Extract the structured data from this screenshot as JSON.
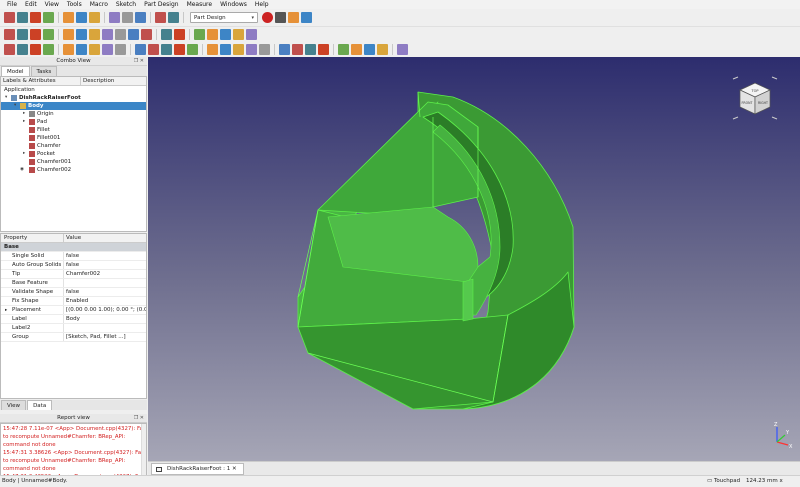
{
  "menu": [
    "File",
    "Edit",
    "View",
    "Tools",
    "Macro",
    "Sketch",
    "Part Design",
    "Measure",
    "Windows",
    "Help"
  ],
  "toolbar": {
    "workbench": "Part Design",
    "row1_icons": [
      "new-icon",
      "open-icon",
      "save-icon",
      "print-icon",
      "cut-icon",
      "copy-icon",
      "paste-icon",
      "undo-icon",
      "redo-icon",
      "refresh-icon",
      "whats-this-icon",
      "workbench-icon",
      "macro-record-icon",
      "macro-stop-icon",
      "macro-edit-icon",
      "macro-run-icon"
    ],
    "row2_icons": [
      "fit-all-icon",
      "fit-selection-icon",
      "draw-style-icon",
      "stereo-icon",
      "view-isometric-icon",
      "view-front-icon",
      "view-top-icon",
      "view-right-icon",
      "view-rear-icon",
      "view-bottom-icon",
      "view-left-icon",
      "measure-icon",
      "link-icon",
      "link-group-icon",
      "part-icon",
      "group-icon",
      "body-icon",
      "body-remove-icon"
    ],
    "row3_icons": [
      "body-create-icon",
      "shape-binder-icon",
      "sub-shape-binder-icon",
      "clone-icon",
      "sketch-icon",
      "point-icon",
      "line-icon",
      "plane-icon",
      "lcs-icon",
      "pad-icon",
      "revolution-icon",
      "loft-icon",
      "pipe-icon",
      "helix-icon",
      "pocket-icon",
      "hole-icon",
      "groove-icon",
      "subtractive-loft-icon",
      "subtractive-pipe-icon",
      "fillet-icon",
      "chamfer-icon",
      "draft-icon",
      "thickness-icon",
      "mirrored-icon",
      "linear-pattern-icon",
      "polar-pattern-icon",
      "multi-transform-icon",
      "boolean-icon"
    ]
  },
  "combo": {
    "title": "Combo View",
    "tabs": [
      "Model",
      "Tasks"
    ],
    "tree_header": [
      "Labels & Attributes",
      "Description"
    ],
    "tree_root": "Application",
    "tree": [
      {
        "label": "DishRackRaiserFoot",
        "depth": 0,
        "exp": "▾",
        "bold": true,
        "icon": "document-icon"
      },
      {
        "label": "Body",
        "depth": 1,
        "exp": "▾",
        "bold": true,
        "sel": true,
        "icon": "body-icon"
      },
      {
        "label": "Origin",
        "depth": 2,
        "exp": "▸",
        "icon": "origin-icon"
      },
      {
        "label": "Pad",
        "depth": 2,
        "exp": "▸",
        "icon": "pad-icon"
      },
      {
        "label": "Fillet",
        "depth": 2,
        "exp": "",
        "icon": "fillet-icon"
      },
      {
        "label": "Fillet001",
        "depth": 2,
        "exp": "",
        "icon": "fillet-icon"
      },
      {
        "label": "Chamfer",
        "depth": 2,
        "exp": "",
        "icon": "chamfer-icon"
      },
      {
        "label": "Pocket",
        "depth": 2,
        "exp": "▸",
        "icon": "pocket-icon"
      },
      {
        "label": "Chamfer001",
        "depth": 2,
        "exp": "",
        "icon": "chamfer-icon"
      },
      {
        "label": "Chamfer002",
        "depth": 2,
        "exp": "",
        "icon": "chamfer-icon",
        "eye": true
      }
    ]
  },
  "props": {
    "headers": [
      "Property",
      "Value"
    ],
    "group": "Base",
    "rows": [
      {
        "k": "Single Solid",
        "v": "false"
      },
      {
        "k": "Auto Group Solids",
        "v": "false"
      },
      {
        "k": "Tip",
        "v": "Chamfer002"
      },
      {
        "k": "Base Feature",
        "v": ""
      },
      {
        "k": "Validate Shape",
        "v": "false"
      },
      {
        "k": "Fix Shape",
        "v": "Enabled"
      },
      {
        "k": "Placement",
        "v": "[(0.00 0.00 1.00); 0.00 °; (0.00 ...",
        "exp": "▸"
      },
      {
        "k": "Label",
        "v": "Body"
      },
      {
        "k": "Label2",
        "v": ""
      },
      {
        "k": "Group",
        "v": "[Sketch, Pad, Fillet ...]"
      }
    ],
    "tabs": [
      "View",
      "Data"
    ]
  },
  "report": {
    "title": "Report view",
    "lines": [
      "15:47:28  7.11e-07 <App> Document.cpp(4327): Failed",
      "to recompute Unnamed#Chamfer: BRep_API:",
      "command not done",
      "15:47:31  3.38626 <App> Document.cpp(4327): Failed",
      "to recompute Unnamed#Chamfer: BRep_API:",
      "command not done",
      "15:47:31  3.43526 <App> Document.cpp(4327): Failed"
    ]
  },
  "document_tab": "DishRackRaiserFoot : 1",
  "navcube": {
    "top": "TOP",
    "front": "FRONT",
    "right": "RIGHT"
  },
  "axes": {
    "x": "X",
    "y": "Y",
    "z": "Z"
  },
  "status": {
    "left": "Body | Unnamed#Body.",
    "nav": "Touchpad",
    "dims": "124.23 mm x 76.81 mm"
  },
  "colors": {
    "selection": "#3b86c7",
    "model_face": "#3fa83a",
    "model_edge": "#5df04a",
    "report_error": "#d21e1e"
  }
}
